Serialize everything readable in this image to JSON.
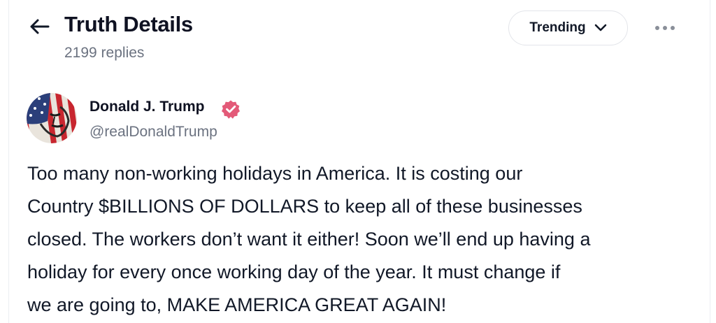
{
  "header": {
    "title": "Truth Details",
    "replies": "2199 replies",
    "sort_label": "Trending",
    "back_icon": "arrow-left-icon",
    "more_icon": "ellipsis-icon"
  },
  "author": {
    "name": "Donald J. Trump",
    "handle": "@realDonaldTrump",
    "verified_color": "#e35a78"
  },
  "post": {
    "text": "Too many non-working holidays in America. It is costing our\nCountry $BILLIONS OF DOLLARS to keep all of these businesses\nclosed. The workers don’t want it either! Soon we’ll end up having a\nholiday for every once working day of the year. It must change if\nwe are going to, MAKE AMERICA GREAT AGAIN!"
  }
}
